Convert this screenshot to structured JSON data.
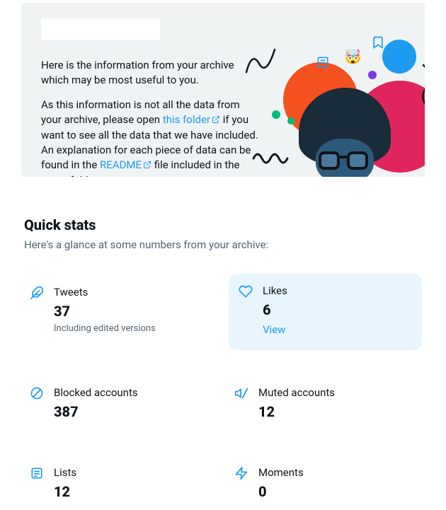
{
  "hero": {
    "p1": "Here is the information from your archive which may be most useful to you.",
    "p2a": "As this information is not all the data from your archive, please open ",
    "folder_link": "this folder",
    "p2b": " if you want to see all the data that we have included. An explanation for each piece of data can be found in the ",
    "readme_link": "README",
    "p2c": " file included in the same folder."
  },
  "quick": {
    "title": "Quick stats",
    "sub": "Here's a glance at some numbers from your archive:"
  },
  "stats": {
    "tweets": {
      "label": "Tweets",
      "value": "37",
      "extra": "Including edited versions"
    },
    "likes": {
      "label": "Likes",
      "value": "6",
      "view": "View"
    },
    "blocked": {
      "label": "Blocked accounts",
      "value": "387"
    },
    "muted": {
      "label": "Muted accounts",
      "value": "12"
    },
    "lists": {
      "label": "Lists",
      "value": "12"
    },
    "moments": {
      "label": "Moments",
      "value": "0"
    }
  }
}
